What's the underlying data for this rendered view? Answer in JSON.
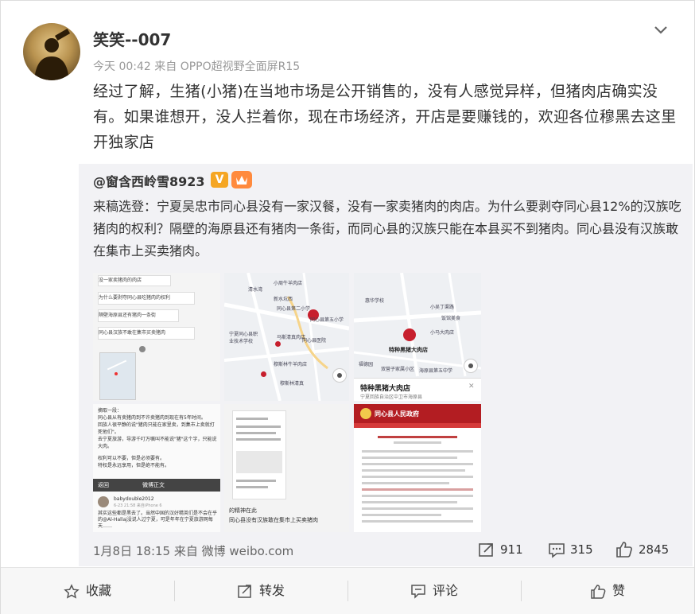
{
  "post": {
    "username": "笑笑--007",
    "meta": "今天 00:42 来自 OPPO超视野全面屏R15",
    "text": "经过了解，生猪(小猪)在当地市场是公开销售的，没有人感觉异样，但猪肉店确实没有。如果谁想开，没人拦着你，现在市场经济，开店是要赚钱的，欢迎各位穆黑去这里开独家店"
  },
  "repost": {
    "author": "@窗含西岭雪8923",
    "text": "来稿选登：宁夏吴忠市同心县没有一家汉餐，没有一家卖猪肉的肉店。为什么要剥夺同心县12%的汉族吃猪肉的权利？隔壁的海原县还有猪肉一条街，而同心县的汉族只能在本县买不到猪肉。同心县没有汉族敢在集市上买卖猪肉。",
    "time_source": "1月8日 18:15 来自 微博 weibo.com",
    "reposts": "911",
    "comments": "315",
    "likes": "2845",
    "images": {
      "img1": {
        "lines": [
          "没一家卖猪肉的肉店",
          "为什么要剥夺同心县吃猪肉的权利",
          "隔壁海原县还有猪肉一条街",
          "同心县汉族不敢在集市买卖猪肉"
        ]
      },
      "img2": {
        "labels": [
          "清水湾",
          "小周牛羊肉店",
          "新水坑西",
          "同心县第二小学",
          "同心县第五小学",
          "宁夏同心县职业技术学校",
          "马斯清真肉店",
          "同心县医院",
          "穆斯林牛羊肉店",
          "穆斯林清真"
        ]
      },
      "img3": {
        "labels": [
          "惠华学校",
          "小吴丁渠路",
          "饭馆美食",
          "小马大肉店",
          "特种黑猪大肉店",
          "福德园",
          "双营子家属小区",
          "海原县第五中学"
        ],
        "popup_title": "特种黑猪大肉店",
        "popup_sub": "宁夏回族自治区中卫市海原县"
      },
      "img4": {
        "lines": [
          "摘取一段：",
          "同心县从有卖猪肉到不许卖猪肉到现在有5年时间。",
          "回族人很平静的说\"猪肉只能在家里卖，到集市上卖就打死他们\"。",
          "去宁夏旅游，导游千叮万嘱叫不能说\"猪\"这个字，只能说大肉。",
          "权利可以不要，但是必须要有。",
          "特权是永远享用，但是绝不能有。"
        ],
        "nav_back": "返回",
        "nav_title": "微博正文",
        "user": "babydouble2012",
        "user_meta": "6-23 21:58 来自iPhone 6",
        "snippet": "其实这些都是黑去了。当然中国的汉好精英们是不会在乎的@Al-Hallaj没说人过宁夏，可是年年在宁夏旅游网每天……"
      },
      "img5": {
        "lines": [
          "的精神在此",
          "同心县没有汉族敢在集市上买卖猪肉"
        ]
      },
      "img6": {
        "site_title": "同心县人民政府"
      }
    }
  },
  "actions": {
    "favorite": "收藏",
    "repost": "转发",
    "comment": "评论",
    "like": "赞"
  },
  "colors": {
    "accent": "#eb7350",
    "background": "#ffffff",
    "repost_bg": "#f2f2f5",
    "gov_red": "#b31d22"
  }
}
